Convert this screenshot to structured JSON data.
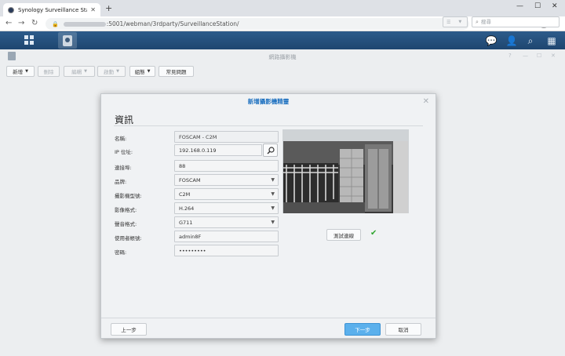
{
  "browser": {
    "tab_title": "Synology Surveillance Station",
    "url_path": ":5001/webman/3rdparty/SurveillanceStation/"
  },
  "app": {
    "title": "網路攝影機",
    "toolbar": {
      "add": "新增",
      "delete": "刪除",
      "edit": "編輯",
      "enable": "啟動",
      "group": "組態",
      "faq": "常見問題"
    },
    "view_select": "☰",
    "search_placeholder": "搜尋"
  },
  "dialog": {
    "title": "新增攝影機精靈",
    "heading": "資訊",
    "fields": {
      "name": {
        "label": "名稱:",
        "value": "FOSCAM - C2M"
      },
      "ip": {
        "label": "IP 位址:",
        "value": "192.168.0.119"
      },
      "port": {
        "label": "連接埠:",
        "value": "88"
      },
      "brand": {
        "label": "品牌:",
        "value": "FOSCAM"
      },
      "model": {
        "label": "攝影機型號:",
        "value": "C2M"
      },
      "video_format": {
        "label": "影像格式:",
        "value": "H.264"
      },
      "audio_format": {
        "label": "聲音格式:",
        "value": "G711"
      },
      "username": {
        "label": "使用者帳號:",
        "value": "admin8F"
      },
      "password": {
        "label": "密碼:",
        "value": "•••••••••"
      }
    },
    "test_connection": "測試連線",
    "prev": "上一步",
    "next": "下一步",
    "cancel": "取消"
  },
  "colors": {
    "dsm_bar": "#2d5b8a",
    "title_accent": "#1b6fbf",
    "next_button": "#5bb0ec",
    "success_check": "#2fa52f"
  },
  "icons": {
    "tab_close": "close-icon",
    "search": "search-icon",
    "check": "check-icon"
  }
}
